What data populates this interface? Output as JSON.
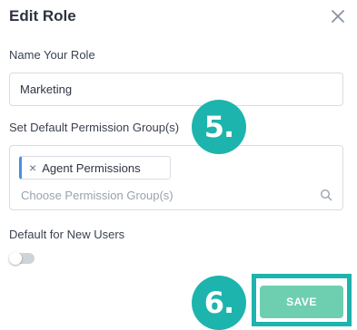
{
  "dialog": {
    "title": "Edit Role",
    "close_icon": "close-icon"
  },
  "role_name": {
    "label": "Name Your Role",
    "value": "Marketing"
  },
  "permissions": {
    "label": "Set Default Permission Group(s)",
    "selected_tags": [
      {
        "label": "Agent Permissions",
        "remove_glyph": "×"
      }
    ],
    "search_placeholder": "Choose Permission Group(s)",
    "search_icon": "search-icon",
    "tag_accent_color": "#4a90e2"
  },
  "default_users": {
    "label": "Default for New Users",
    "toggle_on": false
  },
  "annotations": {
    "step5": "5.",
    "step6": "6.",
    "badge_color": "#1db4ad"
  },
  "actions": {
    "save_label": "SAVE",
    "save_color": "#6ecfb0"
  }
}
